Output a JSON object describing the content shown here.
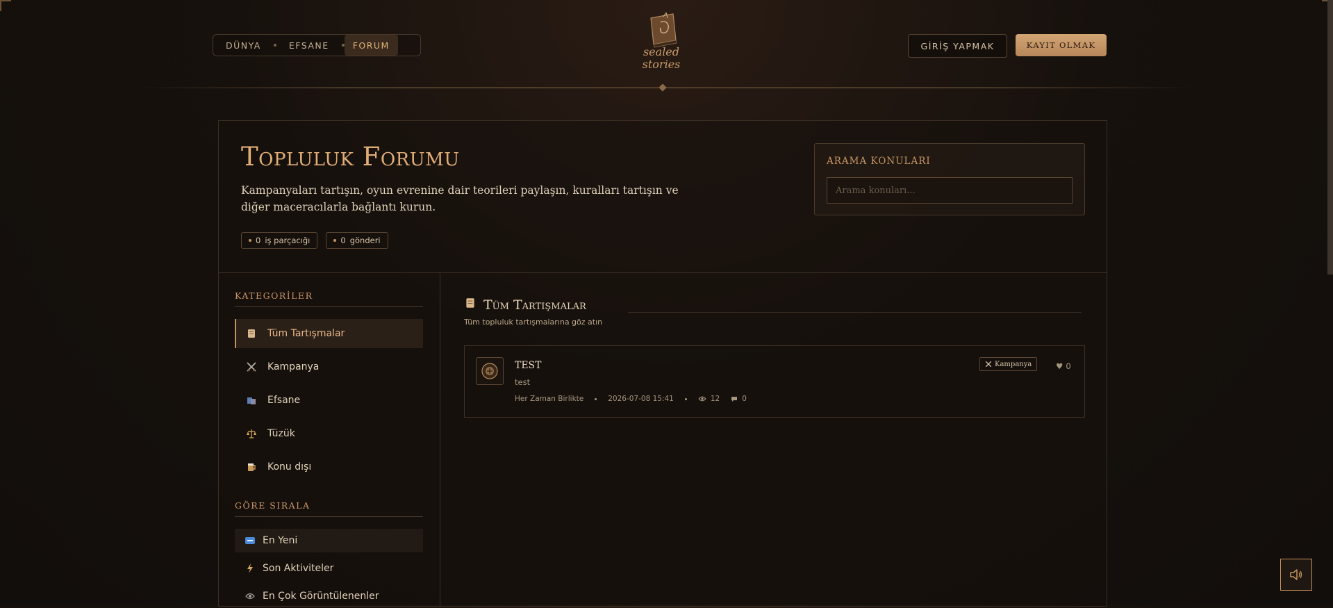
{
  "header": {
    "nav": [
      {
        "label": "DÜNYA",
        "active": false
      },
      {
        "label": "EFSANE",
        "active": false
      },
      {
        "label": "FORUM",
        "active": true
      }
    ],
    "logo_text": [
      "sealed",
      "stories"
    ],
    "login_label": "GİRİŞ YAPMAK",
    "register_label": "KAYIT OLMAK"
  },
  "hero": {
    "title": "Topluluk Forumu",
    "description": "Kampanyaları tartışın, oyun evrenine dair teorileri paylaşın, kuralları tartışın ve diğer maceracılarla bağlantı kurun.",
    "stats": [
      {
        "count": "0",
        "label": "iş parçacığı"
      },
      {
        "count": "0",
        "label": "gönderi"
      }
    ]
  },
  "search": {
    "label": "ARAMA KONULARI",
    "placeholder": "Arama konuları..."
  },
  "sidebar": {
    "categories_heading": "KATEGORİLER",
    "categories": [
      {
        "label": "Tüm Tartışmalar",
        "icon": "scroll-icon",
        "active": true
      },
      {
        "label": "Kampanya",
        "icon": "crossed-swords-icon",
        "active": false
      },
      {
        "label": "Efsane",
        "icon": "books-icon",
        "active": false
      },
      {
        "label": "Tüzük",
        "icon": "scales-icon",
        "active": false
      },
      {
        "label": "Konu dışı",
        "icon": "mug-icon",
        "active": false
      }
    ],
    "sort_heading": "GÖRE SIRALA",
    "sort_options": [
      {
        "label": "En Yeni",
        "icon": "new-icon",
        "active": true
      },
      {
        "label": "Son Aktiviteler",
        "icon": "lightning-icon",
        "active": false
      },
      {
        "label": "En Çok Görüntülenenler",
        "icon": "eye-icon",
        "active": false
      }
    ]
  },
  "content": {
    "title": "Tüm Tartışmalar",
    "subtitle": "Tüm topluluk tartışmalarına göz atın",
    "threads": [
      {
        "title": "TEST",
        "excerpt": "test",
        "author": "Her Zaman Birlikte",
        "date": "2026-07-08 15:41",
        "views": "12",
        "replies": "0",
        "category": "Kampanya",
        "likes": "0"
      }
    ]
  },
  "colors": {
    "accent": "#c4925e",
    "title": "#e0ad76",
    "background": "#17110d"
  }
}
